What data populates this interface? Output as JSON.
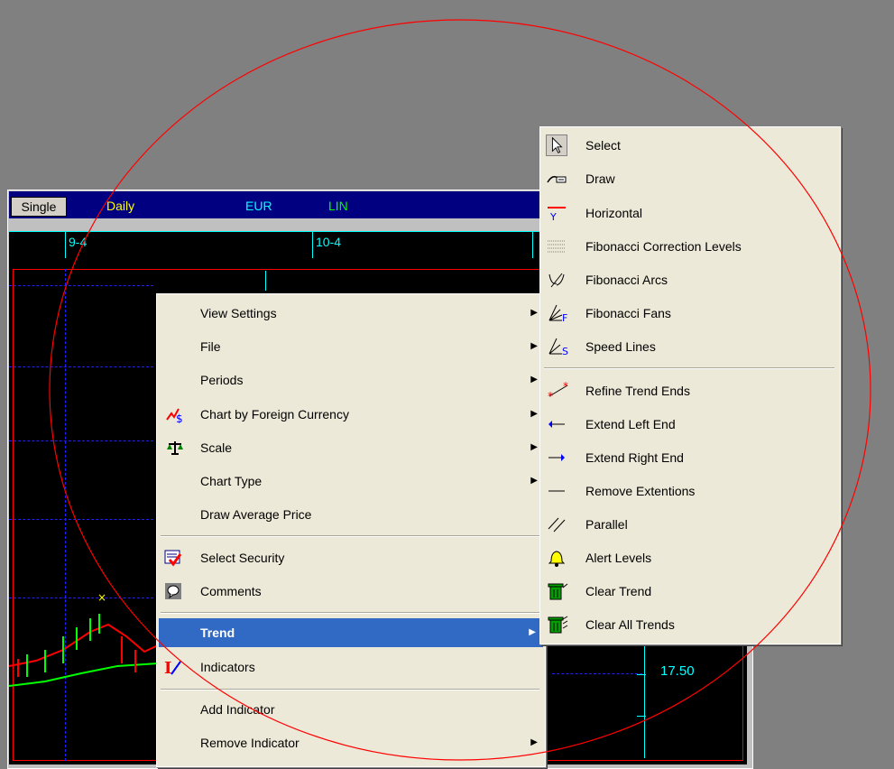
{
  "chart": {
    "single_label": "Single",
    "period": "Daily",
    "currency": "EUR",
    "scale": "LIN",
    "date_labels": [
      "9-4",
      "10-4"
    ],
    "price_label": "17.50",
    "colors": {
      "header": "#000080",
      "grid": "#2020ff",
      "axis": "#00ffff",
      "red": "#ff0000"
    }
  },
  "context_menu": {
    "items": [
      {
        "label": "View Settings",
        "submenu": true
      },
      {
        "label": "File",
        "submenu": true
      },
      {
        "label": "Periods",
        "submenu": true
      },
      {
        "label": "Chart by Foreign Currency",
        "submenu": true,
        "icon": "currency-chart-icon"
      },
      {
        "label": "Scale",
        "submenu": true,
        "icon": "scale-icon"
      },
      {
        "label": "Chart Type",
        "submenu": true
      },
      {
        "label": "Draw Average Price",
        "submenu": false
      },
      {
        "label": "Select Security",
        "submenu": false,
        "icon": "select-security-icon"
      },
      {
        "label": "Comments",
        "submenu": false,
        "icon": "comments-icon"
      },
      {
        "label": "Trend",
        "submenu": true,
        "selected": true
      },
      {
        "label": "Indicators",
        "submenu": false,
        "icon": "indicators-icon"
      },
      {
        "label": "Add Indicator",
        "submenu": false
      },
      {
        "label": "Remove Indicator",
        "submenu": true
      }
    ]
  },
  "trend_submenu": {
    "items": [
      {
        "label": "Select",
        "icon": "pointer-icon"
      },
      {
        "label": "Draw",
        "icon": "draw-icon"
      },
      {
        "label": "Horizontal",
        "icon": "horizontal-line-icon"
      },
      {
        "label": "Fibonacci Correction Levels",
        "icon": "fibonacci-levels-icon"
      },
      {
        "label": "Fibonacci Arcs",
        "icon": "fibonacci-arcs-icon"
      },
      {
        "label": "Fibonacci Fans",
        "icon": "fibonacci-fans-icon"
      },
      {
        "label": "Speed Lines",
        "icon": "speed-lines-icon"
      },
      {
        "label": "Refine Trend Ends",
        "icon": "refine-trend-icon"
      },
      {
        "label": "Extend Left End",
        "icon": "extend-left-icon"
      },
      {
        "label": "Extend Right End",
        "icon": "extend-right-icon"
      },
      {
        "label": "Remove Extentions",
        "icon": "remove-extensions-icon"
      },
      {
        "label": "Parallel",
        "icon": "parallel-icon"
      },
      {
        "label": "Alert Levels",
        "icon": "bell-icon"
      },
      {
        "label": "Clear Trend",
        "icon": "trash-icon"
      },
      {
        "label": "Clear All Trends",
        "icon": "trash-all-icon"
      }
    ]
  }
}
